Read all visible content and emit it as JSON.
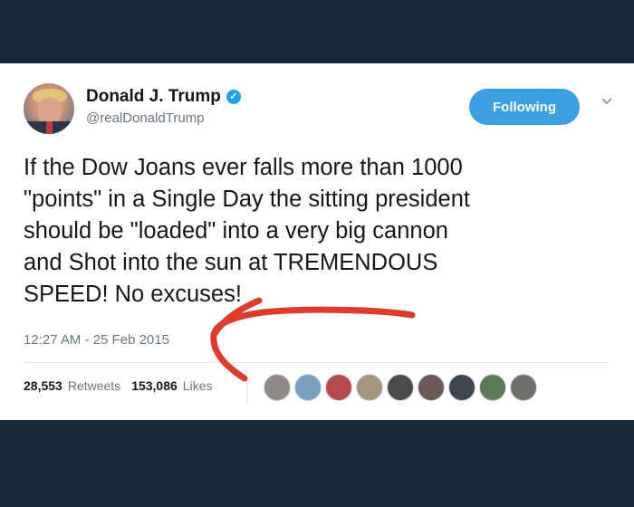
{
  "tweet": {
    "display_name": "Donald J. Trump",
    "handle": "@realDonaldTrump",
    "verified_icon": "verified-badge-icon",
    "follow_label": "Following",
    "text_lines": [
      "If the Dow Joans ever falls more than 1000",
      "\"points\" in a Single Day the sitting president",
      "should be \"loaded\" into a very big cannon",
      "and Shot into the sun at TREMENDOUS",
      "SPEED! No excuses!"
    ],
    "timestamp": "12:27 AM - 25 Feb 2015",
    "retweets_count": "28,553",
    "retweets_label": "Retweets",
    "likes_count": "153,086",
    "likes_label": "Likes",
    "liker_avatars": [
      "#8f8a86",
      "#7aa0c0",
      "#b44a4a",
      "#a4967a",
      "#4b4b4b",
      "#6b5a58",
      "#3f4650",
      "#5c7a58",
      "#70706a"
    ]
  },
  "colors": {
    "background": "#1b2a3a",
    "card": "#ffffff",
    "accent": "#3b9fe0",
    "annotation": "#e03a2a"
  }
}
